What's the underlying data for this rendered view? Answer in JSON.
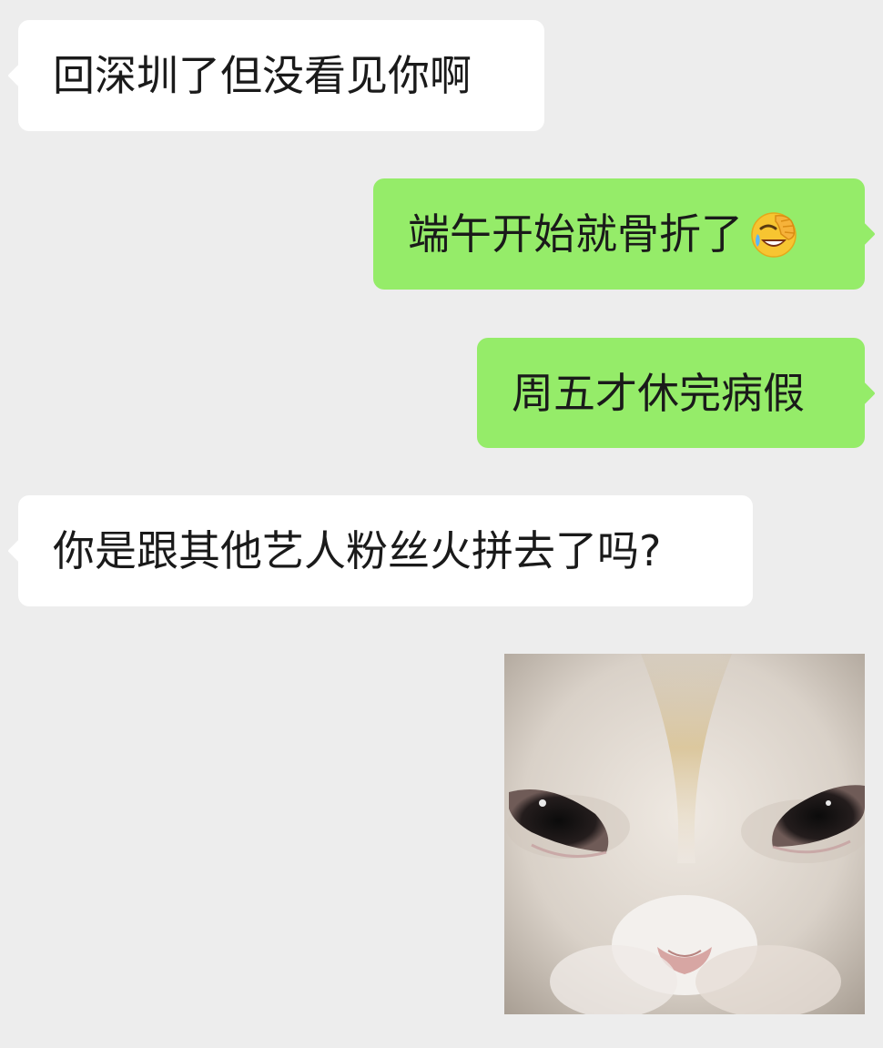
{
  "messages": [
    {
      "sender": "contact",
      "text": "回深圳了但没看见你啊"
    },
    {
      "sender": "me",
      "text": "端午开始就骨折了",
      "emoji": "face-palm-laughing-emoji"
    },
    {
      "sender": "me",
      "text": "周五才休完病假"
    },
    {
      "sender": "contact",
      "text": "你是跟其他艺人粉丝火拼去了吗?"
    },
    {
      "sender": "me",
      "type": "image",
      "image_subject": "white-cat-face-sticker"
    }
  ],
  "colors": {
    "background": "#ededed",
    "incoming_bubble": "#ffffff",
    "outgoing_bubble": "#95ec69",
    "text": "#1a1a1a"
  }
}
